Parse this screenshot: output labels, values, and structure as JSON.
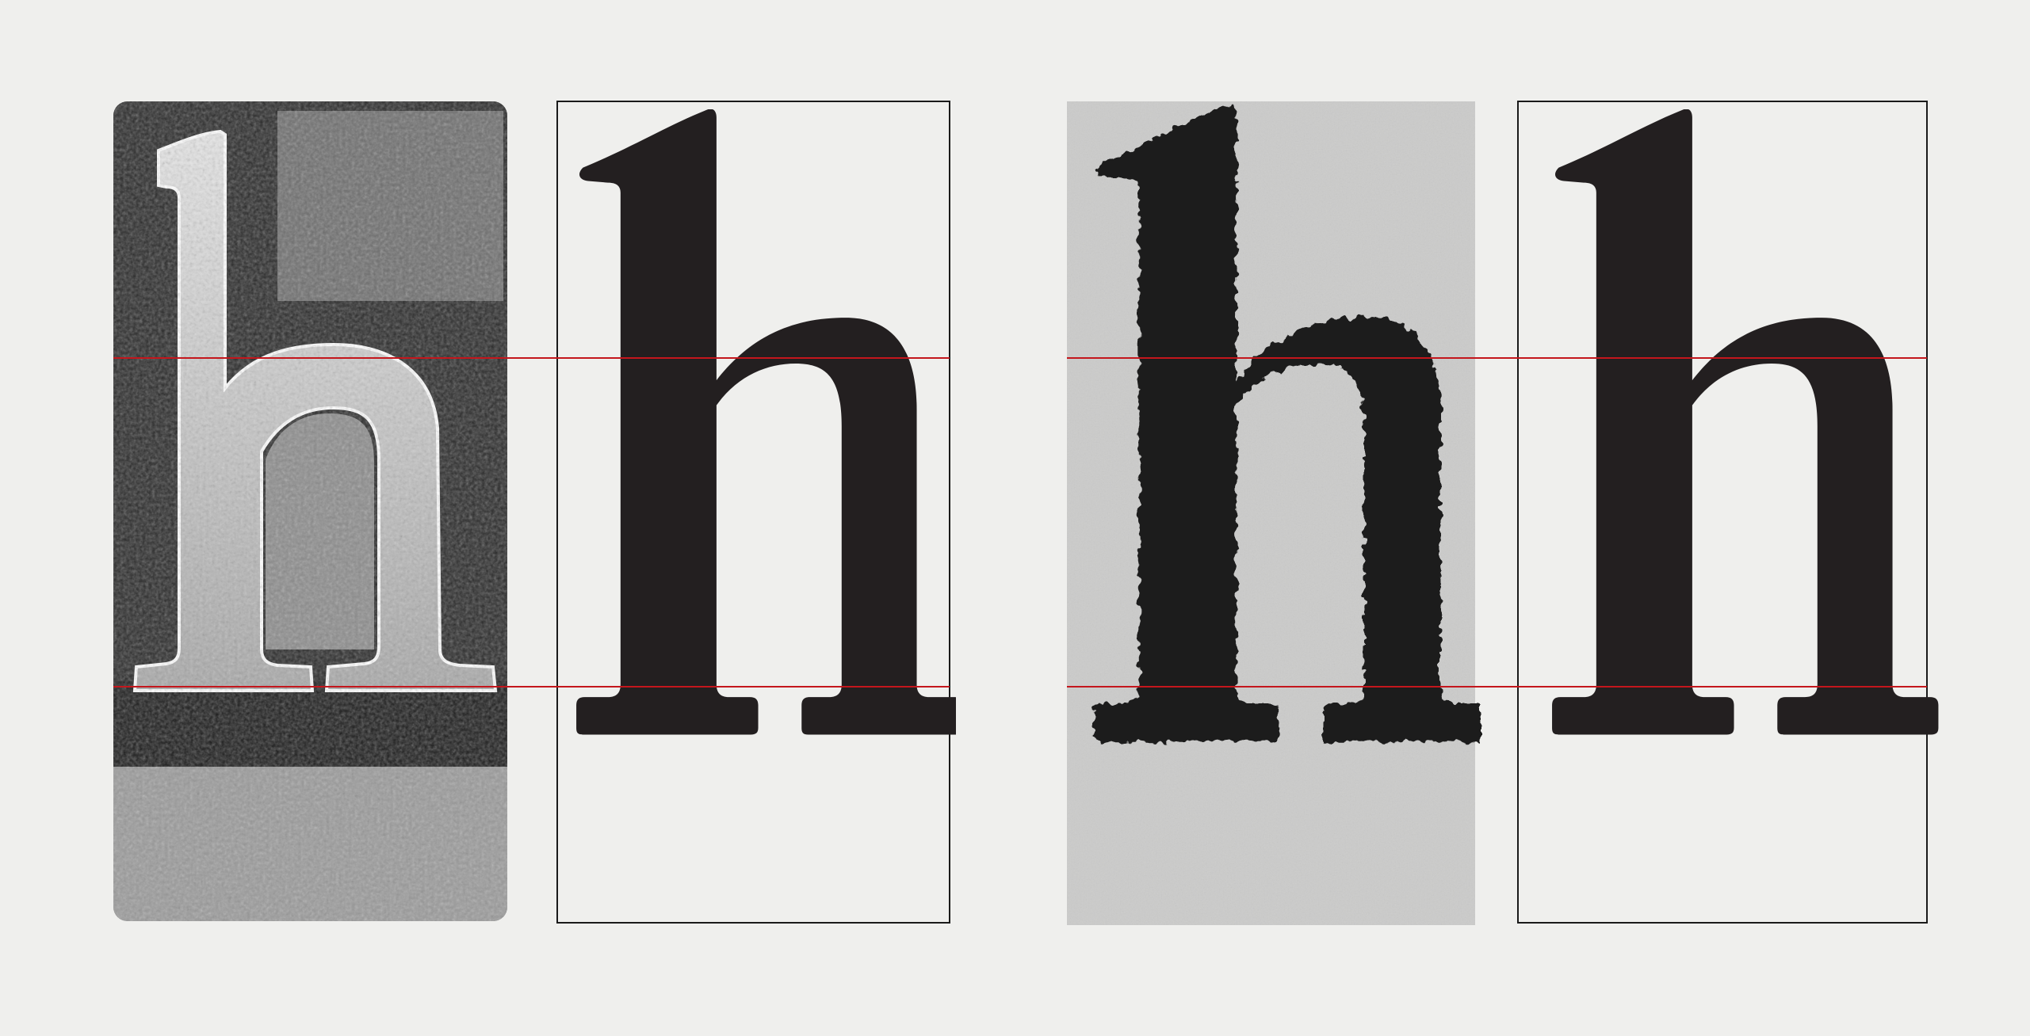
{
  "figure": {
    "background_color": "#efefed",
    "reference_line_color": "#c4161c",
    "frame_line_color": "#1a1a1a",
    "glyph_color": "#231f20",
    "panels": [
      {
        "id": "metal-type",
        "kind": "photo-of-metal-sort",
        "glyph": "h"
      },
      {
        "id": "digital-outline-1",
        "kind": "framed-digital-glyph",
        "glyph": "h"
      },
      {
        "id": "printed-impression",
        "kind": "photo-of-print",
        "glyph": "h"
      },
      {
        "id": "digital-outline-2",
        "kind": "framed-digital-glyph",
        "glyph": "h"
      }
    ],
    "reference_lines": [
      "x-height",
      "baseline"
    ]
  }
}
